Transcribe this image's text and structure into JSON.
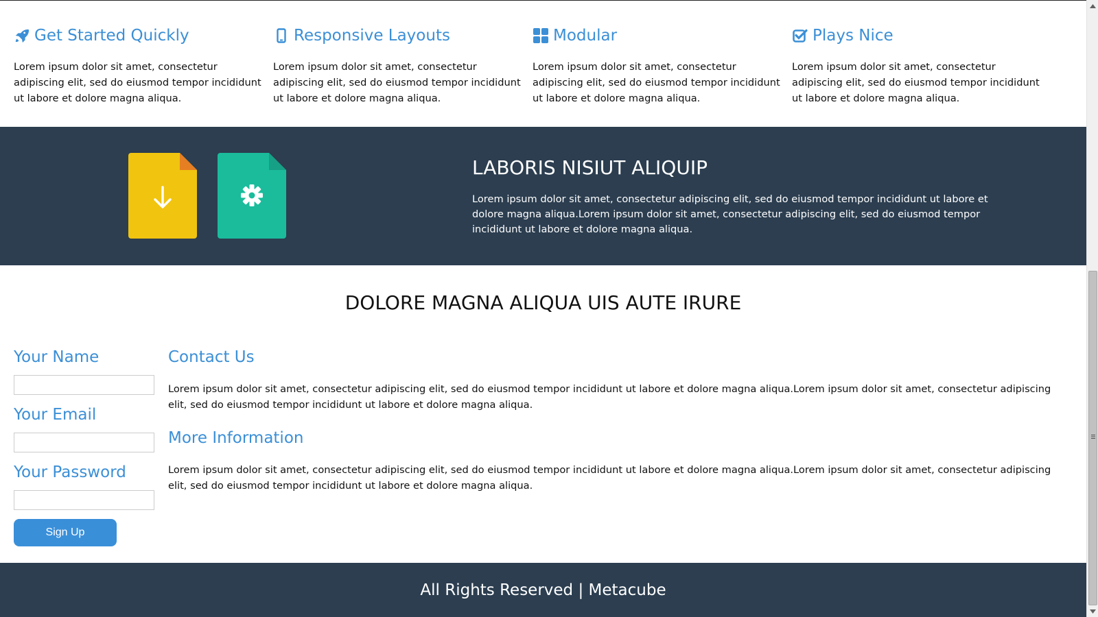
{
  "features": [
    {
      "icon": "rocket-icon",
      "title": "Get Started Quickly",
      "text": "Lorem ipsum dolor sit amet, consectetur adipiscing elit, sed do eiusmod tempor incididunt ut labore et dolore magna aliqua."
    },
    {
      "icon": "mobile-icon",
      "title": "Responsive Layouts",
      "text": "Lorem ipsum dolor sit amet, consectetur adipiscing elit, sed do eiusmod tempor incididunt ut labore et dolore magna aliqua."
    },
    {
      "icon": "grid-icon",
      "title": "Modular",
      "text": "Lorem ipsum dolor sit amet, consectetur adipiscing elit, sed do eiusmod tempor incididunt ut labore et dolore magna aliqua."
    },
    {
      "icon": "check-square-icon",
      "title": "Plays Nice",
      "text": "Lorem ipsum dolor sit amet, consectetur adipiscing elit, sed do eiusmod tempor incididunt ut labore et dolore magna aliqua."
    }
  ],
  "band": {
    "title": "LABORIS NISIUT ALIQUIP",
    "text": "Lorem ipsum dolor sit amet, consectetur adipiscing elit, sed do eiusmod tempor incididunt ut labore et dolore magna aliqua.Lorem ipsum dolor sit amet, consectetur adipiscing elit, sed do eiusmod tempor incididunt ut labore et dolore magna aliqua.",
    "doc_icons": [
      "download-file-icon",
      "settings-file-icon"
    ]
  },
  "section": {
    "title": "DOLORE MAGNA ALIQUA UIS AUTE IRURE"
  },
  "form": {
    "name_label": "Your Name",
    "name_value": "",
    "email_label": "Your Email",
    "email_value": "",
    "password_label": "Your Password",
    "password_value": "",
    "submit_label": "Sign Up"
  },
  "contact": {
    "title": "Contact Us",
    "text": "Lorem ipsum dolor sit amet, consectetur adipiscing elit, sed do eiusmod tempor incididunt ut labore et dolore magna aliqua.Lorem ipsum dolor sit amet, consectetur adipiscing elit, sed do eiusmod tempor incididunt ut labore et dolore magna aliqua."
  },
  "more_info": {
    "title": "More Information",
    "text": "Lorem ipsum dolor sit amet, consectetur adipiscing elit, sed do eiusmod tempor incididunt ut labore et dolore magna aliqua.Lorem ipsum dolor sit amet, consectetur adipiscing elit, sed do eiusmod tempor incididunt ut labore et dolore magna aliqua."
  },
  "footer": {
    "text": "All Rights Reserved | Metacube"
  },
  "colors": {
    "accent": "#3b8fd6",
    "dark_band": "#2c3e50",
    "doc_yellow": "#f1c40f",
    "doc_green": "#1abc9c",
    "button": "#3a8fd9"
  }
}
